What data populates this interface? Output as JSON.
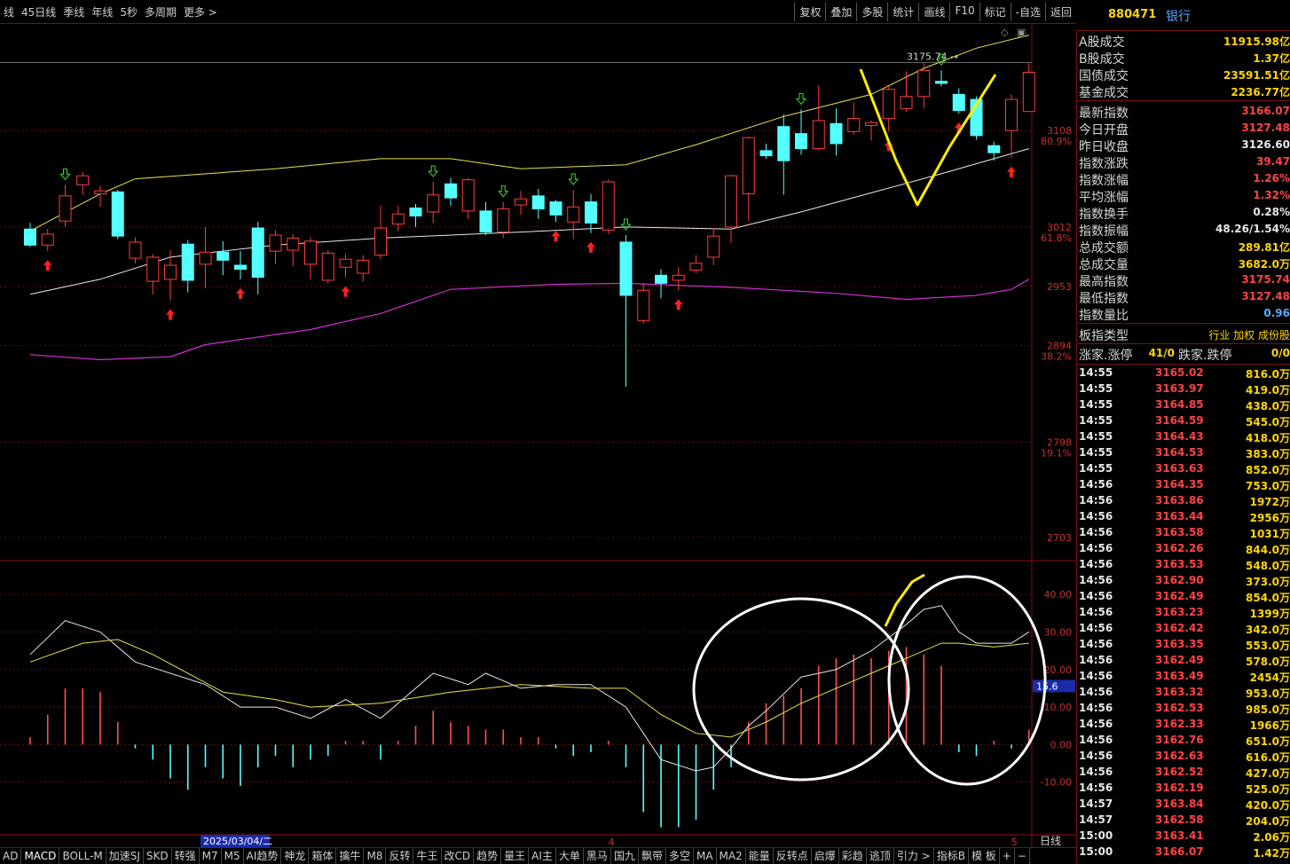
{
  "toolbar": {
    "left": [
      "线",
      "45日线",
      "季线",
      "年线",
      "5秒",
      "多周期",
      "更多 >"
    ],
    "right": [
      "复权",
      "叠加",
      "多股",
      "统计",
      "画线",
      "F10",
      "标记",
      "-自选",
      "返回"
    ]
  },
  "quote": {
    "code": "880471",
    "name": "银行",
    "turnover": [
      {
        "k": "A股成交",
        "v": "11915.98亿"
      },
      {
        "k": "B股成交",
        "v": "1.37亿"
      },
      {
        "k": "国债成交",
        "v": "23591.51亿"
      },
      {
        "k": "基金成交",
        "v": "2236.77亿"
      }
    ],
    "stats": [
      {
        "k": "最新指数",
        "v": "3166.07",
        "c": "#ff4444"
      },
      {
        "k": "今日开盘",
        "v": "3127.48",
        "c": "#ff4444"
      },
      {
        "k": "昨日收盘",
        "v": "3126.60",
        "c": "#e8e8e8"
      },
      {
        "k": "指数涨跌",
        "v": "39.47",
        "c": "#ff4444"
      },
      {
        "k": "指数涨幅",
        "v": "1.26%",
        "c": "#ff4444"
      },
      {
        "k": "平均涨幅",
        "v": "1.32%",
        "c": "#ff4444"
      },
      {
        "k": "指数换手",
        "v": "0.28%",
        "c": "#e8e8e8"
      },
      {
        "k": "指数振幅",
        "v": "48.26/1.54%",
        "c": "#e8e8e8"
      },
      {
        "k": "总成交额",
        "v": "289.81亿",
        "c": "#ffd700"
      },
      {
        "k": "总成交量",
        "v": "3682.0万",
        "c": "#ffd700"
      },
      {
        "k": "最高指数",
        "v": "3175.74",
        "c": "#ff4444"
      },
      {
        "k": "最低指数",
        "v": "3127.48",
        "c": "#ff4444"
      },
      {
        "k": "指数量比",
        "v": "0.96",
        "c": "#55aaff"
      }
    ],
    "type_label": "板指类型",
    "type_value": "行业 加权 成份股",
    "updown_label1": "涨家.涨停",
    "updown_val1": "41/0",
    "updown_label2": "跌家.跌停",
    "updown_val2": "0/0",
    "ticks": [
      [
        "14:55",
        "3165.02",
        "816.0万"
      ],
      [
        "14:55",
        "3163.97",
        "419.0万"
      ],
      [
        "14:55",
        "3164.85",
        "438.0万"
      ],
      [
        "14:55",
        "3164.59",
        "545.0万"
      ],
      [
        "14:55",
        "3164.43",
        "418.0万"
      ],
      [
        "14:55",
        "3164.53",
        "383.0万"
      ],
      [
        "14:55",
        "3163.63",
        "852.0万"
      ],
      [
        "14:56",
        "3164.35",
        "753.0万"
      ],
      [
        "14:56",
        "3163.86",
        "1972万"
      ],
      [
        "14:56",
        "3163.44",
        "2956万"
      ],
      [
        "14:56",
        "3163.58",
        "1031万"
      ],
      [
        "14:56",
        "3162.26",
        "844.0万"
      ],
      [
        "14:56",
        "3163.53",
        "548.0万"
      ],
      [
        "14:56",
        "3162.90",
        "373.0万"
      ],
      [
        "14:56",
        "3162.49",
        "854.0万"
      ],
      [
        "14:56",
        "3163.23",
        "1399万"
      ],
      [
        "14:56",
        "3162.42",
        "342.0万"
      ],
      [
        "14:56",
        "3163.35",
        "553.0万"
      ],
      [
        "14:56",
        "3162.49",
        "578.0万"
      ],
      [
        "14:56",
        "3163.49",
        "2454万"
      ],
      [
        "14:56",
        "3163.32",
        "953.0万"
      ],
      [
        "14:56",
        "3162.53",
        "985.0万"
      ],
      [
        "14:56",
        "3162.33",
        "1966万"
      ],
      [
        "14:56",
        "3162.76",
        "651.0万"
      ],
      [
        "14:56",
        "3162.63",
        "616.0万"
      ],
      [
        "14:56",
        "3162.52",
        "427.0万"
      ],
      [
        "14:56",
        "3162.19",
        "525.0万"
      ],
      [
        "14:57",
        "3163.84",
        "420.0万"
      ],
      [
        "14:57",
        "3162.58",
        "204.0万"
      ],
      [
        "15:00",
        "3163.41",
        "2.06万"
      ],
      [
        "15:00",
        "3166.07",
        "1.42万"
      ]
    ]
  },
  "bottom": {
    "tabs": [
      "AD",
      "MACD",
      "BOLL-M",
      "加速SJ",
      "SKD",
      "转强",
      "M7",
      "M5",
      "AI趋势",
      "神龙",
      "箱体",
      "擒牛",
      "M8",
      "反转",
      "牛王",
      "改CD",
      "趋势",
      "量王",
      "AI主",
      "大单",
      "黑马",
      "国九",
      "飘带",
      "多空",
      "MA",
      "MA2",
      "能量",
      "反转点",
      "启爆",
      "彩趋",
      "逃顶",
      "引力 >",
      "指标B",
      "模 板",
      "+",
      "−"
    ],
    "period": "日线"
  },
  "chart_data": {
    "type": "candlestick",
    "price_axis": {
      "ylim": [
        2680,
        3215
      ],
      "ticks": [
        {
          "v": 3108,
          "label": "3108",
          "pct": "80.9%"
        },
        {
          "v": 3012,
          "label": "3012",
          "pct": "61.8%"
        },
        {
          "v": 2953,
          "label": "2953",
          "pct": ""
        },
        {
          "v": 2894,
          "label": "2894",
          "pct": "38.2%"
        },
        {
          "v": 2798,
          "label": "2798",
          "pct": "19.1%"
        },
        {
          "v": 2703,
          "label": "2703",
          "pct": ""
        }
      ]
    },
    "high_annotation": "3175.74",
    "date_label": "2025/03/04/二",
    "month_labels": [
      {
        "i": 11,
        "label": "3"
      },
      {
        "i": 34,
        "label": "4"
      },
      {
        "i": 57,
        "label": "5"
      }
    ],
    "candles": [
      [
        3010,
        2994,
        3016,
        2992
      ],
      [
        2994,
        3005,
        3010,
        2988
      ],
      [
        3018,
        3043,
        3054,
        3012
      ],
      [
        3054,
        3063,
        3067,
        3044
      ],
      [
        3045,
        3048,
        3053,
        3032
      ],
      [
        3047,
        3003,
        3049,
        3000
      ],
      [
        2981,
        2997,
        3002,
        2976
      ],
      [
        2958,
        2982,
        2985,
        2945
      ],
      [
        2960,
        2974,
        2989,
        2939
      ],
      [
        2995,
        2959,
        2999,
        2947
      ],
      [
        2975,
        2987,
        3012,
        2951
      ],
      [
        2987,
        2979,
        2998,
        2964
      ],
      [
        2974,
        2970,
        2988,
        2960
      ],
      [
        3011,
        2962,
        3017,
        2945
      ],
      [
        2988,
        3004,
        3009,
        2975
      ],
      [
        2989,
        3001,
        3005,
        2973
      ],
      [
        2975,
        2998,
        3002,
        2960
      ],
      [
        2959,
        2986,
        2989,
        2956
      ],
      [
        2972,
        2980,
        2985,
        2962
      ],
      [
        2966,
        2979,
        2984,
        2958
      ],
      [
        2984,
        3011,
        3033,
        2980
      ],
      [
        3015,
        3025,
        3033,
        3008
      ],
      [
        3031,
        3023,
        3035,
        3012
      ],
      [
        3027,
        3044,
        3057,
        3016
      ],
      [
        3055,
        3041,
        3061,
        3033
      ],
      [
        3028,
        3059,
        3061,
        3020
      ],
      [
        3028,
        3007,
        3037,
        3004
      ],
      [
        3007,
        3030,
        3037,
        3001
      ],
      [
        3034,
        3040,
        3048,
        3024
      ],
      [
        3043,
        3030,
        3050,
        3020
      ],
      [
        3037,
        3024,
        3039,
        3017
      ],
      [
        3017,
        3032,
        3049,
        3000
      ],
      [
        3037,
        3016,
        3045,
        3006
      ],
      [
        3009,
        3057,
        3059,
        3005
      ],
      [
        2997,
        2944,
        3004,
        2853
      ],
      [
        2919,
        2949,
        2956,
        2916
      ],
      [
        2964,
        2956,
        2970,
        2941
      ],
      [
        2959,
        2964,
        2972,
        2949
      ],
      [
        2969,
        2976,
        2984,
        2966
      ],
      [
        2982,
        3003,
        3011,
        2974
      ],
      [
        3012,
        3063,
        3064,
        2996
      ],
      [
        3045,
        3101,
        3102,
        3018
      ],
      [
        3088,
        3083,
        3095,
        3080
      ],
      [
        3112,
        3078,
        3124,
        3044
      ],
      [
        3105,
        3090,
        3129,
        3084
      ],
      [
        3090,
        3118,
        3153,
        3088
      ],
      [
        3115,
        3095,
        3130,
        3083
      ],
      [
        3107,
        3120,
        3136,
        3104
      ],
      [
        3113,
        3116,
        3118,
        3098
      ],
      [
        3120,
        3149,
        3152,
        3107
      ],
      [
        3130,
        3142,
        3167,
        3127
      ],
      [
        3142,
        3168,
        3175,
        3130
      ],
      [
        3157,
        3155,
        3168,
        3152
      ],
      [
        3144,
        3128,
        3150,
        3125
      ],
      [
        3139,
        3103,
        3142,
        3099
      ],
      [
        3093,
        3086,
        3097,
        3078
      ],
      [
        3108,
        3139,
        3144,
        3081
      ],
      [
        3127,
        3166,
        3175,
        3127
      ]
    ],
    "boll": {
      "upper": [
        [
          0,
          3008
        ],
        [
          4,
          3045
        ],
        [
          6,
          3060
        ],
        [
          14,
          3070
        ],
        [
          20,
          3080
        ],
        [
          24,
          3080
        ],
        [
          28,
          3070
        ],
        [
          34,
          3074
        ],
        [
          38,
          3094
        ],
        [
          43,
          3122
        ],
        [
          48,
          3144
        ],
        [
          51,
          3170
        ],
        [
          54,
          3190
        ],
        [
          57,
          3203
        ]
      ],
      "mid": [
        [
          0,
          2945
        ],
        [
          4,
          2960
        ],
        [
          8,
          2982
        ],
        [
          14,
          2994
        ],
        [
          20,
          3001
        ],
        [
          28,
          3007
        ],
        [
          34,
          3012
        ],
        [
          40,
          3010
        ],
        [
          44,
          3027
        ],
        [
          48,
          3046
        ],
        [
          52,
          3065
        ],
        [
          55,
          3080
        ],
        [
          57,
          3090
        ]
      ],
      "lower": [
        [
          0,
          2885
        ],
        [
          4,
          2880
        ],
        [
          8,
          2883
        ],
        [
          10,
          2895
        ],
        [
          16,
          2910
        ],
        [
          20,
          2926
        ],
        [
          24,
          2950
        ],
        [
          30,
          2955
        ],
        [
          34,
          2956
        ],
        [
          40,
          2952
        ],
        [
          46,
          2946
        ],
        [
          50,
          2940
        ],
        [
          54,
          2944
        ],
        [
          56,
          2950
        ],
        [
          57,
          2960
        ]
      ]
    },
    "macd": {
      "ylim": [
        -24,
        49
      ],
      "ticks": [
        {
          "v": 40,
          "label": "40.00"
        },
        {
          "v": 30,
          "label": "30.00"
        },
        {
          "v": 20,
          "label": "20.00"
        },
        {
          "v": 10,
          "label": "10.00"
        },
        {
          "v": 0,
          "label": "0.00"
        },
        {
          "v": -10,
          "label": "-10.00"
        }
      ],
      "current_label": "15.6",
      "dif": [
        [
          0,
          24
        ],
        [
          2,
          33
        ],
        [
          4,
          30
        ],
        [
          6,
          22
        ],
        [
          10,
          16
        ],
        [
          12,
          10
        ],
        [
          14,
          10
        ],
        [
          16,
          7
        ],
        [
          18,
          12
        ],
        [
          20,
          7
        ],
        [
          23,
          19
        ],
        [
          25,
          16
        ],
        [
          26,
          19
        ],
        [
          28,
          15
        ],
        [
          30,
          16
        ],
        [
          32,
          16
        ],
        [
          34,
          10
        ],
        [
          36,
          -4
        ],
        [
          38,
          -7
        ],
        [
          39,
          -6
        ],
        [
          40,
          -1
        ],
        [
          41,
          5
        ],
        [
          42,
          9
        ],
        [
          44,
          18
        ],
        [
          46,
          20
        ],
        [
          48,
          25
        ],
        [
          50,
          32
        ],
        [
          51,
          36
        ],
        [
          52,
          37
        ],
        [
          53,
          30
        ],
        [
          54,
          27
        ],
        [
          55,
          27
        ],
        [
          56,
          27
        ],
        [
          57,
          30
        ]
      ],
      "dea": [
        [
          0,
          22
        ],
        [
          3,
          27
        ],
        [
          5,
          28
        ],
        [
          7,
          24
        ],
        [
          11,
          14
        ],
        [
          14,
          12
        ],
        [
          16,
          10
        ],
        [
          20,
          11
        ],
        [
          24,
          14
        ],
        [
          28,
          16
        ],
        [
          32,
          15
        ],
        [
          34,
          15
        ],
        [
          36,
          8
        ],
        [
          38,
          3
        ],
        [
          40,
          2
        ],
        [
          42,
          6
        ],
        [
          44,
          11
        ],
        [
          46,
          15
        ],
        [
          48,
          19
        ],
        [
          50,
          23
        ],
        [
          52,
          27
        ],
        [
          53,
          27
        ],
        [
          55,
          26
        ],
        [
          57,
          27
        ]
      ],
      "hist": [
        [
          0,
          2
        ],
        [
          1,
          8
        ],
        [
          2,
          15
        ],
        [
          3,
          15
        ],
        [
          4,
          14
        ],
        [
          5,
          6
        ],
        [
          6,
          -1
        ],
        [
          7,
          -4
        ],
        [
          8,
          -9
        ],
        [
          9,
          -12
        ],
        [
          10,
          -6
        ],
        [
          11,
          -9
        ],
        [
          12,
          -11
        ],
        [
          13,
          -6
        ],
        [
          14,
          -3
        ],
        [
          15,
          -6
        ],
        [
          16,
          -4
        ],
        [
          17,
          -3
        ],
        [
          18,
          1
        ],
        [
          19,
          1
        ],
        [
          20,
          -4
        ],
        [
          21,
          1
        ],
        [
          22,
          5
        ],
        [
          23,
          9
        ],
        [
          24,
          6
        ],
        [
          25,
          5
        ],
        [
          26,
          4
        ],
        [
          27,
          4
        ],
        [
          28,
          2
        ],
        [
          29,
          2
        ],
        [
          30,
          -1
        ],
        [
          31,
          -3
        ],
        [
          32,
          -2
        ],
        [
          33,
          1
        ],
        [
          34,
          -6
        ],
        [
          35,
          -18
        ],
        [
          36,
          -22
        ],
        [
          37,
          -22
        ],
        [
          38,
          -20
        ],
        [
          39,
          -12
        ],
        [
          40,
          -6
        ],
        [
          41,
          6
        ],
        [
          42,
          11
        ],
        [
          43,
          13
        ],
        [
          44,
          15
        ],
        [
          45,
          21
        ],
        [
          46,
          23
        ],
        [
          47,
          24
        ],
        [
          48,
          23
        ],
        [
          49,
          25
        ],
        [
          50,
          26
        ],
        [
          51,
          24
        ],
        [
          52,
          21
        ],
        [
          53,
          -2
        ],
        [
          54,
          -3
        ],
        [
          55,
          1
        ],
        [
          56,
          -1
        ],
        [
          57,
          4
        ]
      ]
    }
  }
}
